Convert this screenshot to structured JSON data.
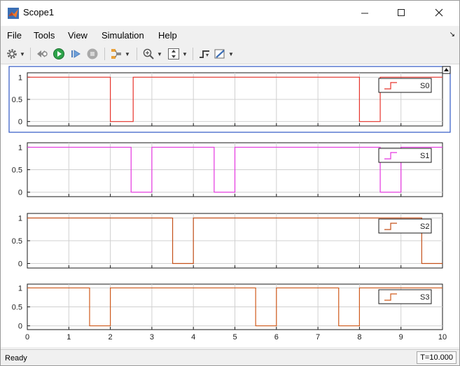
{
  "window": {
    "title": "Scope1",
    "minimize_icon": "minimize-icon",
    "maximize_icon": "maximize-icon",
    "close_icon": "close-icon"
  },
  "menu": {
    "items": [
      "File",
      "Tools",
      "View",
      "Simulation",
      "Help"
    ]
  },
  "toolbar": {
    "icons": [
      "gear-icon",
      "stop-sim-icon",
      "run-icon",
      "step-forward-icon",
      "stop-icon",
      "signal-select-icon",
      "zoom-in-icon",
      "scale-axes-icon",
      "triggers-icon",
      "measurements-icon"
    ]
  },
  "status": {
    "left": "Ready",
    "right": "T=10.000"
  },
  "colors": {
    "S0": "#e8342c",
    "S1": "#e536e0",
    "S2": "#c4501a",
    "S3": "#d05a1c",
    "active_border": "#2f57c4"
  },
  "chart_data": [
    {
      "type": "line",
      "series": [
        {
          "name": "S0",
          "x": [
            0,
            2,
            2,
            2.55,
            2.55,
            8,
            8,
            8.5,
            8.5,
            10
          ],
          "y": [
            1,
            1,
            0,
            0,
            1,
            1,
            0,
            0,
            1,
            1
          ]
        }
      ],
      "xlim": [
        0,
        10
      ],
      "ylim": [
        -0.1,
        1.1
      ],
      "yticks": [
        "0",
        "0.5",
        "1"
      ],
      "grid": true,
      "legend": "top-right",
      "active": true
    },
    {
      "type": "line",
      "series": [
        {
          "name": "S1",
          "x": [
            0,
            2.5,
            2.5,
            3,
            3,
            4.5,
            4.5,
            5,
            5,
            8.5,
            8.5,
            9,
            9,
            10
          ],
          "y": [
            1,
            1,
            0,
            0,
            1,
            1,
            0,
            0,
            1,
            1,
            0,
            0,
            1,
            1
          ]
        }
      ],
      "xlim": [
        0,
        10
      ],
      "ylim": [
        -0.1,
        1.1
      ],
      "yticks": [
        "0",
        "0.5",
        "1"
      ],
      "grid": true,
      "legend": "top-right"
    },
    {
      "type": "line",
      "series": [
        {
          "name": "S2",
          "x": [
            0,
            3.5,
            3.5,
            4,
            4,
            9.5,
            9.5,
            10
          ],
          "y": [
            1,
            1,
            0,
            0,
            1,
            1,
            0,
            0
          ]
        }
      ],
      "xlim": [
        0,
        10
      ],
      "ylim": [
        -0.1,
        1.1
      ],
      "yticks": [
        "0",
        "0.5",
        "1"
      ],
      "grid": true,
      "legend": "top-right"
    },
    {
      "type": "line",
      "series": [
        {
          "name": "S3",
          "x": [
            0,
            1.5,
            1.5,
            2,
            2,
            5.5,
            5.5,
            6,
            6,
            7.5,
            7.5,
            8,
            8,
            10
          ],
          "y": [
            1,
            1,
            0,
            0,
            1,
            1,
            0,
            0,
            1,
            1,
            0,
            0,
            1,
            1
          ]
        }
      ],
      "xlim": [
        0,
        10
      ],
      "ylim": [
        -0.1,
        1.1
      ],
      "yticks": [
        "0",
        "0.5",
        "1"
      ],
      "xticks": [
        "0",
        "1",
        "2",
        "3",
        "4",
        "5",
        "6",
        "7",
        "8",
        "9",
        "10"
      ],
      "grid": true,
      "legend": "top-right"
    }
  ]
}
